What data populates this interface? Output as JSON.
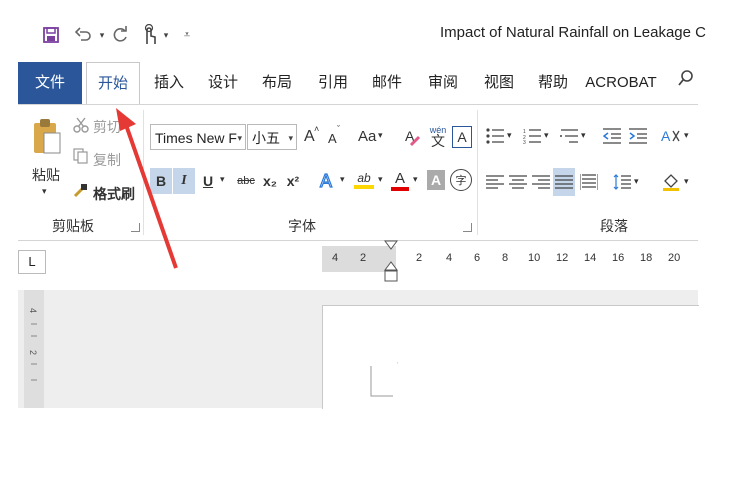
{
  "quick_access": {
    "save_icon": "save-icon",
    "undo_icon": "undo-icon",
    "redo_icon": "redo-icon",
    "touch_mode_icon": "touch-icon",
    "customize_icon": "customize-icon"
  },
  "title": "Impact of Natural Rainfall on Leakage C",
  "tabs": [
    {
      "label": "文件",
      "state": "file"
    },
    {
      "label": "开始",
      "state": "active"
    },
    {
      "label": "插入",
      "state": "normal"
    },
    {
      "label": "设计",
      "state": "normal"
    },
    {
      "label": "布局",
      "state": "normal"
    },
    {
      "label": "引用",
      "state": "normal"
    },
    {
      "label": "邮件",
      "state": "normal"
    },
    {
      "label": "审阅",
      "state": "normal"
    },
    {
      "label": "视图",
      "state": "normal"
    },
    {
      "label": "帮助",
      "state": "normal"
    },
    {
      "label": "ACROBAT",
      "state": "normal"
    }
  ],
  "clipboard": {
    "paste_label": "粘贴",
    "cut_label": "剪切",
    "copy_label": "复制",
    "format_painter_label": "格式刷",
    "group_label": "剪贴板"
  },
  "font": {
    "font_name": "Times New F",
    "font_size": "小五",
    "grow_label": "A",
    "shrink_label": "A",
    "case_label": "Aa",
    "bold_label": "B",
    "italic_label": "I",
    "underline_label": "U",
    "strike_label": "abc",
    "subscript_label": "x₂",
    "superscript_label": "x²",
    "highlight_label": "ab",
    "font_color_label": "A",
    "char_shading_label": "A",
    "enclose_label": "字",
    "phonetic_label": "文",
    "char_border_label": "A",
    "group_label": "字体"
  },
  "paragraph": {
    "group_label": "段落"
  },
  "ruler": {
    "tab_selector": "L",
    "ticks": [
      "4",
      "2",
      "2",
      "4",
      "6",
      "8",
      "10",
      "12",
      "14",
      "16",
      "18",
      "20"
    ]
  },
  "colors": {
    "file_tab": "#2b579a",
    "accent": "#2b579a",
    "arrow": "#e53935",
    "highlight_yellow": "#ffd700",
    "font_red": "#e00000"
  }
}
